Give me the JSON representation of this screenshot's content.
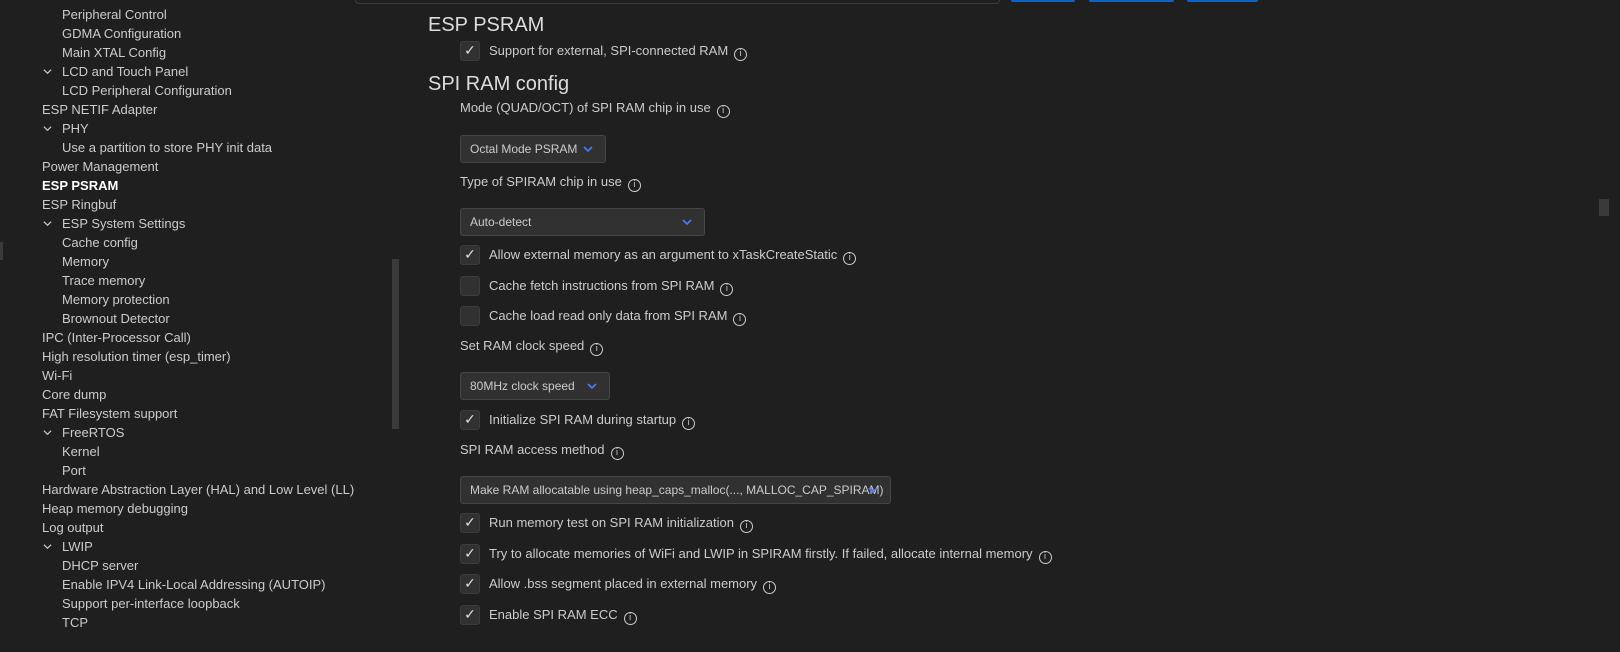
{
  "tree": {
    "items": [
      {
        "label": "Peripheral Control",
        "level": 1,
        "expanded": null,
        "active": false
      },
      {
        "label": "GDMA Configuration",
        "level": 1,
        "expanded": null,
        "active": false
      },
      {
        "label": "Main XTAL Config",
        "level": 1,
        "expanded": null,
        "active": false
      },
      {
        "label": "LCD and Touch Panel",
        "level": 1,
        "expanded": true,
        "active": false
      },
      {
        "label": "LCD Peripheral Configuration",
        "level": 1,
        "expanded": null,
        "active": false
      },
      {
        "label": "ESP NETIF Adapter",
        "level": 0,
        "expanded": null,
        "active": false
      },
      {
        "label": "PHY",
        "level": 1,
        "expanded": true,
        "active": false
      },
      {
        "label": "Use a partition to store PHY init data",
        "level": 1,
        "expanded": null,
        "active": false
      },
      {
        "label": "Power Management",
        "level": 0,
        "expanded": null,
        "active": false
      },
      {
        "label": "ESP PSRAM",
        "level": 0,
        "expanded": null,
        "active": true
      },
      {
        "label": "ESP Ringbuf",
        "level": 0,
        "expanded": null,
        "active": false
      },
      {
        "label": "ESP System Settings",
        "level": 1,
        "expanded": true,
        "active": false
      },
      {
        "label": "Cache config",
        "level": 1,
        "expanded": null,
        "active": false
      },
      {
        "label": "Memory",
        "level": 1,
        "expanded": null,
        "active": false
      },
      {
        "label": "Trace memory",
        "level": 1,
        "expanded": null,
        "active": false
      },
      {
        "label": "Memory protection",
        "level": 1,
        "expanded": null,
        "active": false
      },
      {
        "label": "Brownout Detector",
        "level": 1,
        "expanded": null,
        "active": false
      },
      {
        "label": "IPC (Inter-Processor Call)",
        "level": 0,
        "expanded": null,
        "active": false
      },
      {
        "label": "High resolution timer (esp_timer)",
        "level": 0,
        "expanded": null,
        "active": false
      },
      {
        "label": "Wi-Fi",
        "level": 0,
        "expanded": null,
        "active": false
      },
      {
        "label": "Core dump",
        "level": 0,
        "expanded": null,
        "active": false
      },
      {
        "label": "FAT Filesystem support",
        "level": 0,
        "expanded": null,
        "active": false
      },
      {
        "label": "FreeRTOS",
        "level": 1,
        "expanded": true,
        "active": false
      },
      {
        "label": "Kernel",
        "level": 1,
        "expanded": null,
        "active": false
      },
      {
        "label": "Port",
        "level": 1,
        "expanded": null,
        "active": false
      },
      {
        "label": "Hardware Abstraction Layer (HAL) and Low Level (LL)",
        "level": 0,
        "expanded": null,
        "active": false
      },
      {
        "label": "Heap memory debugging",
        "level": 0,
        "expanded": null,
        "active": false
      },
      {
        "label": "Log output",
        "level": 0,
        "expanded": null,
        "active": false
      },
      {
        "label": "LWIP",
        "level": 1,
        "expanded": true,
        "active": false
      },
      {
        "label": "DHCP server",
        "level": 1,
        "expanded": null,
        "active": false
      },
      {
        "label": "Enable IPV4 Link-Local Addressing (AUTOIP)",
        "level": 1,
        "expanded": null,
        "active": false
      },
      {
        "label": "Support per-interface loopback",
        "level": 1,
        "expanded": null,
        "active": false
      },
      {
        "label": "TCP",
        "level": 1,
        "expanded": null,
        "active": false
      }
    ]
  },
  "main": {
    "sections": [
      {
        "title": "ESP PSRAM"
      },
      {
        "title": "SPI RAM config"
      }
    ],
    "controls": [
      {
        "type": "checkbox",
        "label": "Support for external, SPI-connected RAM",
        "checked": true
      },
      {
        "type": "label",
        "label": "Mode (QUAD/OCT) of SPI RAM chip in use"
      },
      {
        "type": "select",
        "value": "Octal Mode PSRAM"
      },
      {
        "type": "label",
        "label": "Type of SPIRAM chip in use"
      },
      {
        "type": "select",
        "value": "Auto-detect"
      },
      {
        "type": "checkbox",
        "label": "Allow external memory as an argument to xTaskCreateStatic",
        "checked": true
      },
      {
        "type": "checkbox",
        "label": "Cache fetch instructions from SPI RAM",
        "checked": false
      },
      {
        "type": "checkbox",
        "label": "Cache load read only data from SPI RAM",
        "checked": false
      },
      {
        "type": "label",
        "label": "Set RAM clock speed"
      },
      {
        "type": "select",
        "value": "80MHz clock speed"
      },
      {
        "type": "checkbox",
        "label": "Initialize SPI RAM during startup",
        "checked": true
      },
      {
        "type": "label",
        "label": "SPI RAM access method"
      },
      {
        "type": "select",
        "value": "Make RAM allocatable using heap_caps_malloc(..., MALLOC_CAP_SPIRAM)"
      },
      {
        "type": "checkbox",
        "label": "Run memory test on SPI RAM initialization",
        "checked": true
      },
      {
        "type": "checkbox",
        "label": "Try to allocate memories of WiFi and LWIP in SPIRAM firstly. If failed, allocate internal memory",
        "checked": true
      },
      {
        "type": "checkbox",
        "label": "Allow .bss segment placed in external memory",
        "checked": true
      },
      {
        "type": "checkbox",
        "label": "Enable SPI RAM ECC",
        "checked": true
      }
    ]
  },
  "icons": {
    "info": "info-icon",
    "check": "check-icon",
    "chevron": "chevron-down-icon",
    "info_glyph": "i",
    "check_glyph": "✓"
  },
  "colors": {
    "background": "#1f1f1f",
    "text": "#cccccc",
    "accent": "#0e63c8",
    "caret": "#4d7dff",
    "control_bg": "#313131"
  }
}
